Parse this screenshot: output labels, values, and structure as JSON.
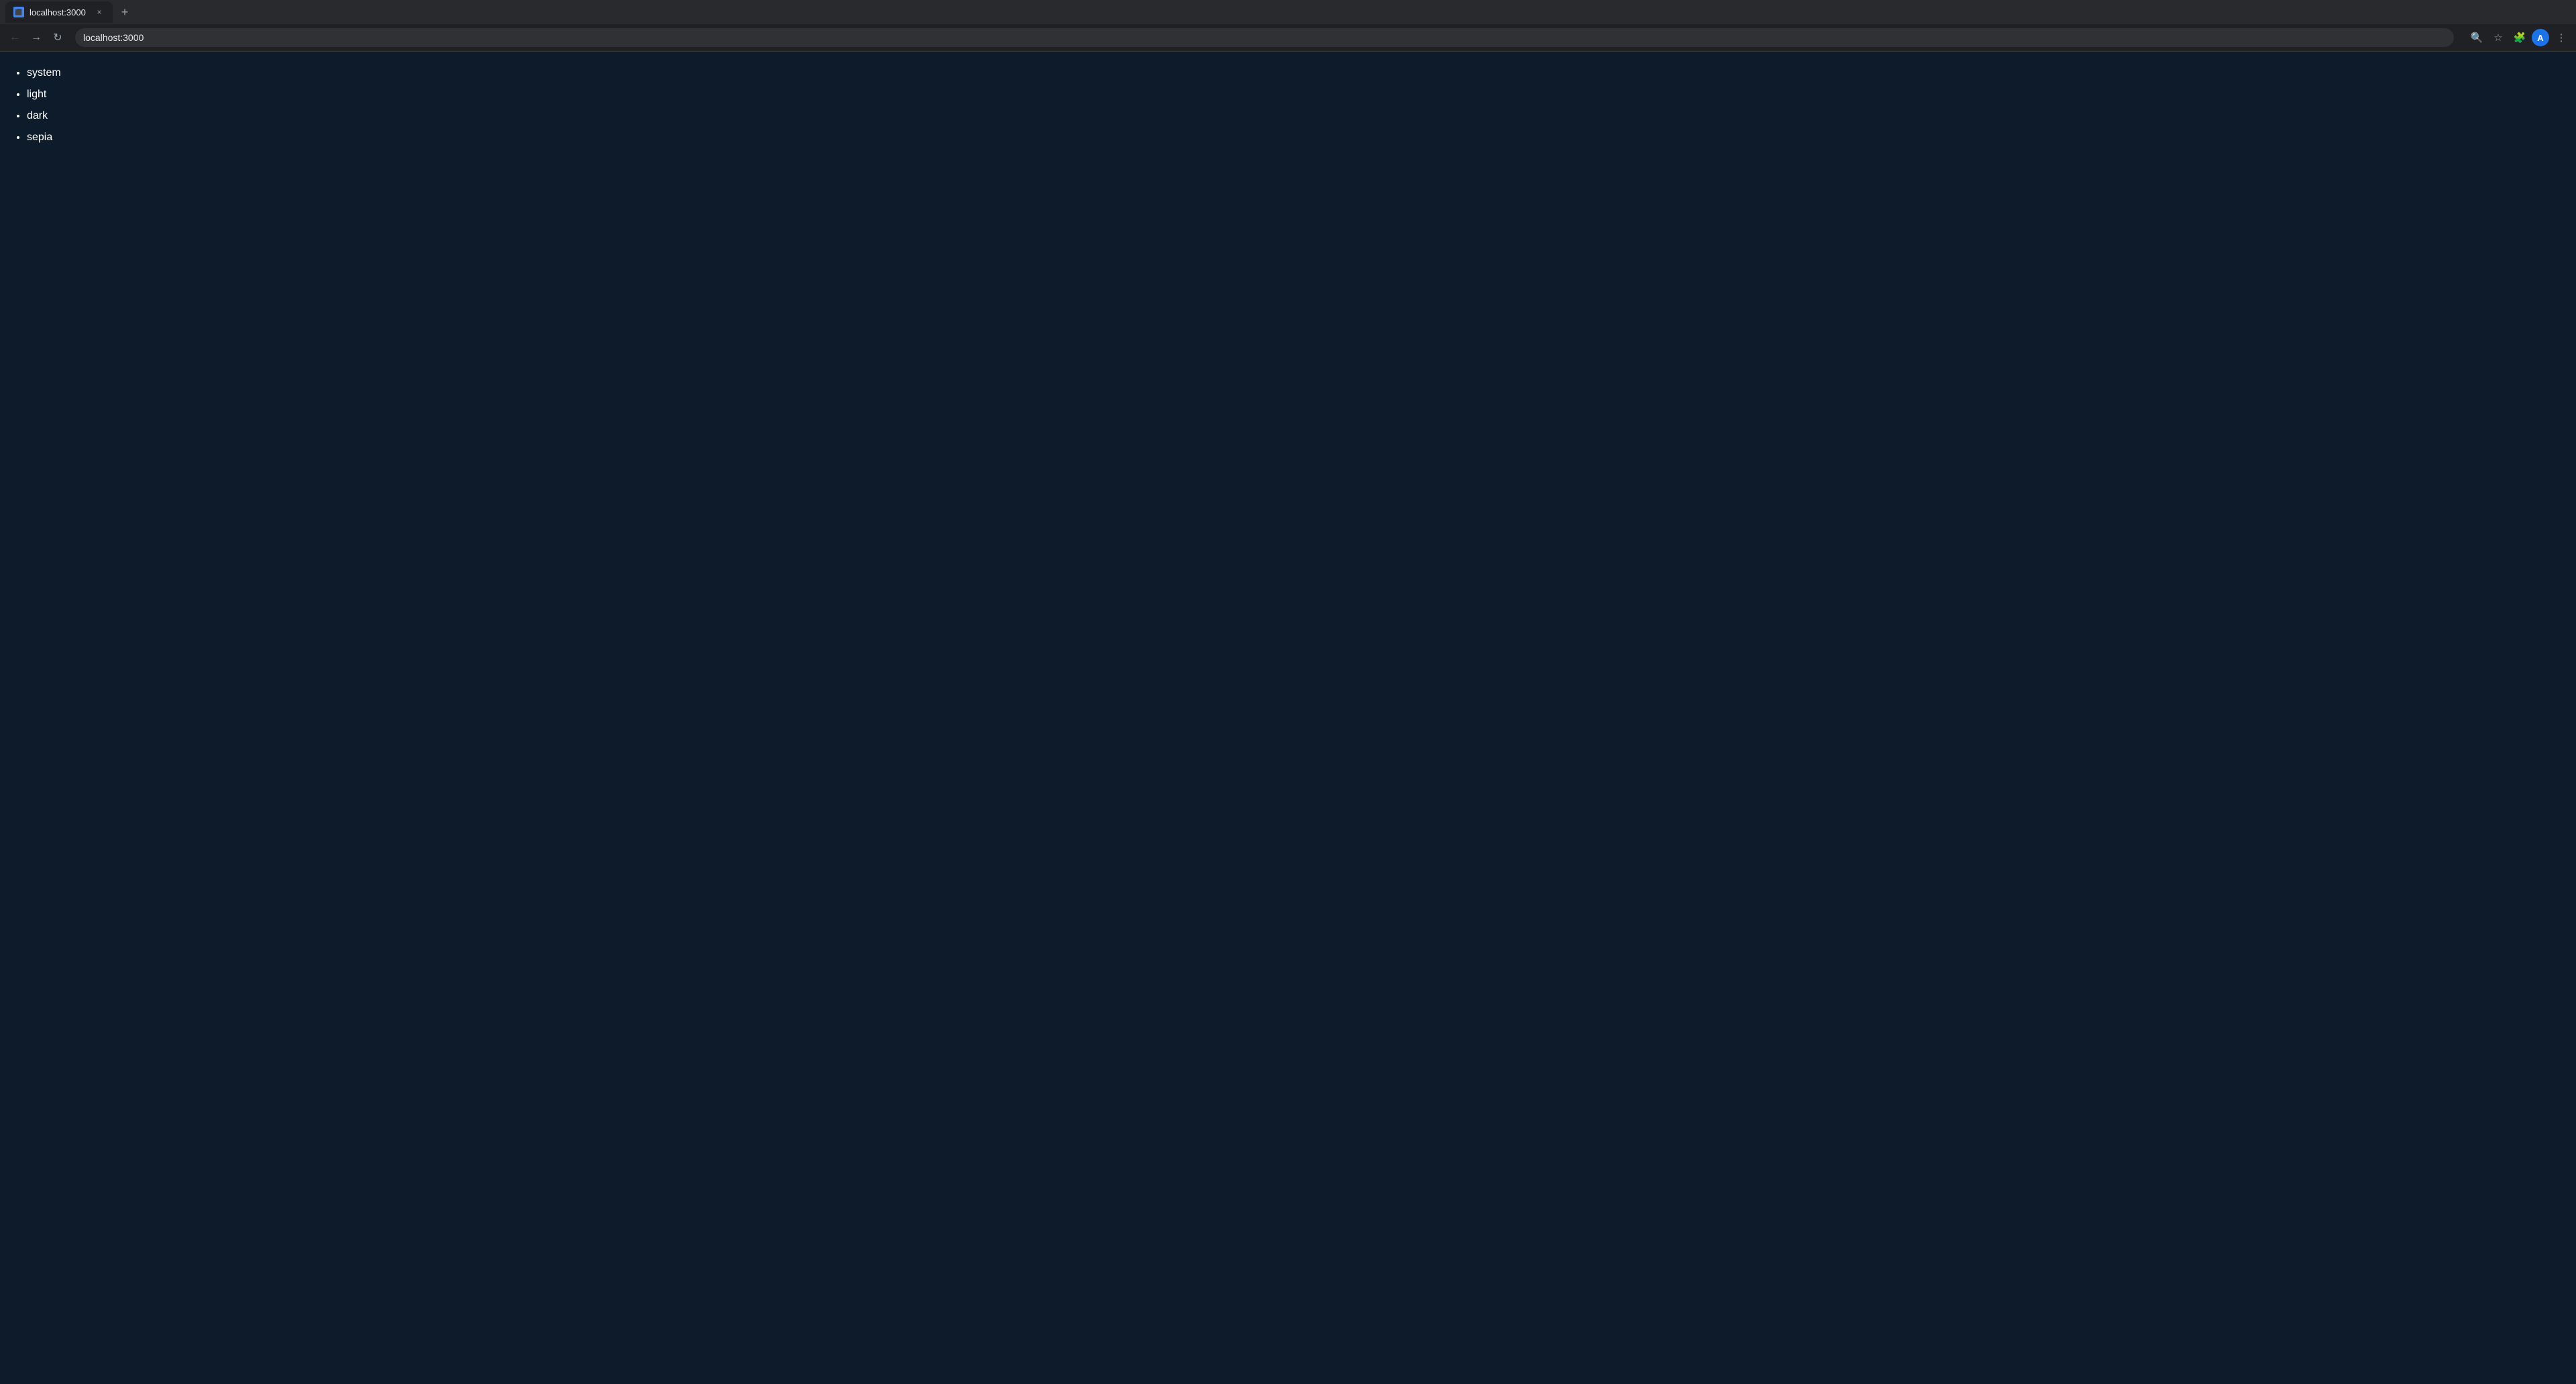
{
  "browser": {
    "tab": {
      "favicon_label": "L",
      "title": "localhost:3000",
      "close_label": "×"
    },
    "new_tab_label": "+",
    "nav": {
      "back_label": "←",
      "forward_label": "→",
      "reload_label": "↻",
      "url": "localhost:3000"
    },
    "actions": {
      "search_label": "🔍",
      "bookmark_label": "☆",
      "extension_label": "🧩",
      "profile_label": "A",
      "menu_label": "⋮"
    }
  },
  "page": {
    "items": [
      {
        "id": "system",
        "label": "system"
      },
      {
        "id": "light",
        "label": "light"
      },
      {
        "id": "dark",
        "label": "dark"
      },
      {
        "id": "sepia",
        "label": "sepia"
      }
    ]
  }
}
